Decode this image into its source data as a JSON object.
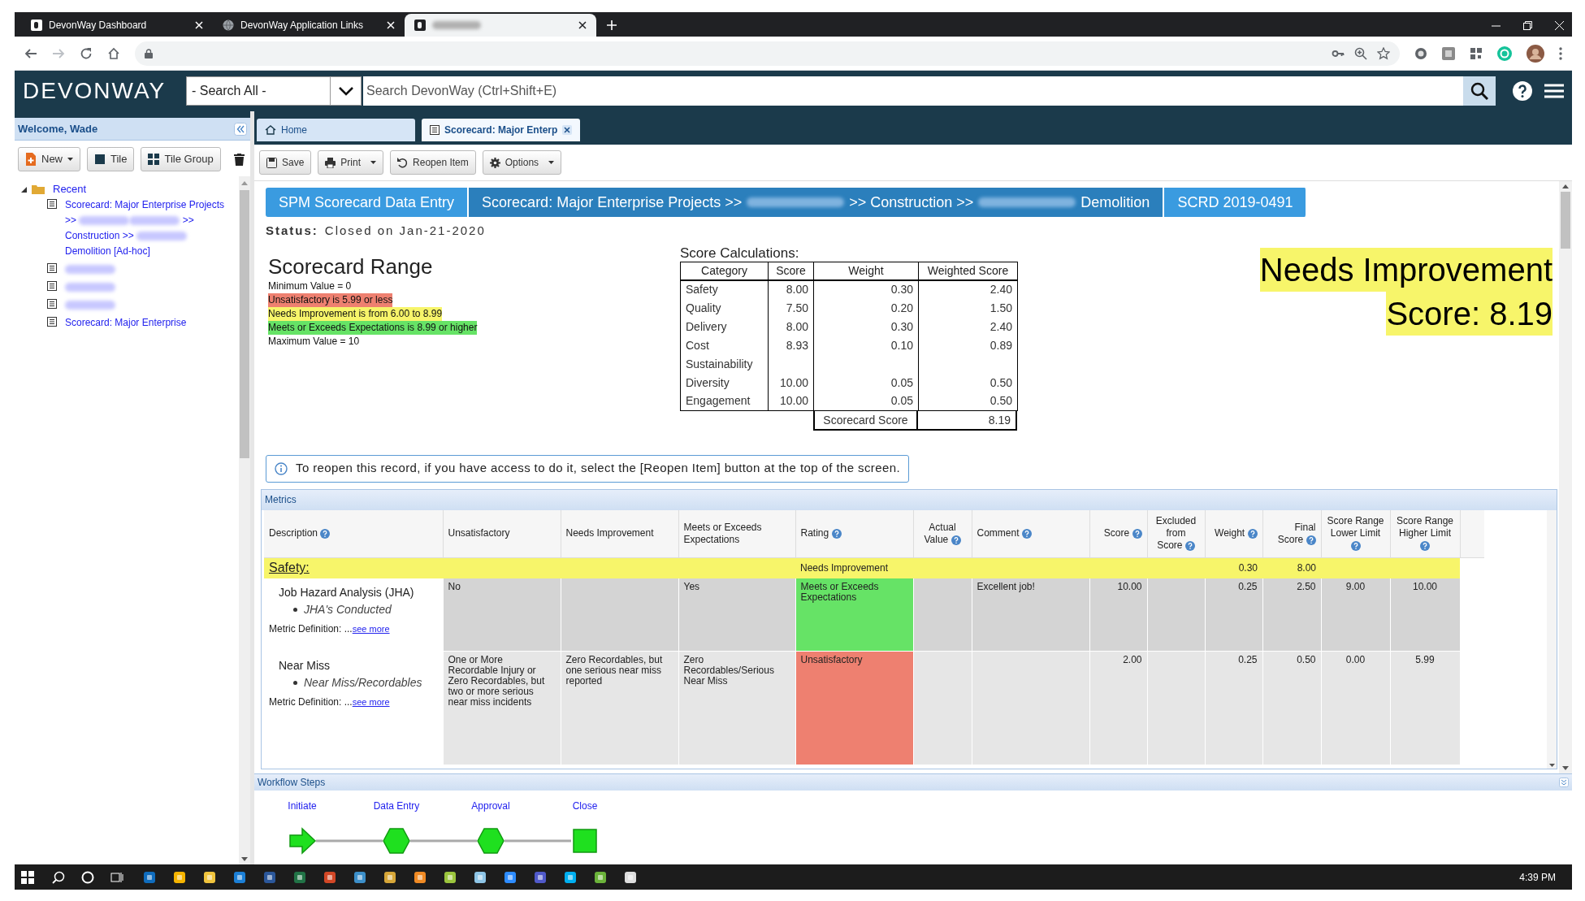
{
  "browser": {
    "tabs": [
      {
        "title": "DevonWay Dashboard",
        "kind": "logo",
        "selected": false
      },
      {
        "title": "DevonWay Application Links",
        "kind": "globe",
        "selected": false
      },
      {
        "title_blurred": true,
        "kind": "logo",
        "selected": true
      }
    ]
  },
  "app_header": {
    "logo": "DEVONWAY",
    "search_scope": "- Search All -",
    "search_placeholder": "Search DevonWay (Ctrl+Shift+E)"
  },
  "sidebar": {
    "title": "Welcome, Wade",
    "buttons": [
      {
        "label": "New",
        "kind": "new",
        "dropdown": true
      },
      {
        "label": "Tile",
        "kind": "tile",
        "dropdown": false
      },
      {
        "label": "Tile Group",
        "kind": "tile_group",
        "dropdown": false
      }
    ],
    "tree": [
      {
        "label": "Recent",
        "expanded": true,
        "children": [
          {
            "parts": [
              {
                "text": "Scorecard: Major Enterprise Projects >> "
              },
              {
                "kind": "blurred"
              },
              {
                "kind": "blurred"
              },
              {
                "text": " >> Construction >> "
              },
              {
                "kind": "blurred"
              },
              {
                "text": " Demolition [Ad-hoc]"
              }
            ]
          },
          {
            "parts": [
              {
                "kind": "blurred"
              }
            ]
          },
          {
            "parts": [
              {
                "kind": "blurred"
              }
            ]
          },
          {
            "parts": [
              {
                "kind": "blurred"
              }
            ]
          },
          {
            "parts": [
              {
                "text": "Scorecard: Major Enterprise"
              }
            ]
          }
        ]
      }
    ]
  },
  "main_tabs": [
    {
      "label": "Home",
      "kind": "home",
      "selected": false,
      "closable": false
    },
    {
      "label": "Scorecard: Major Enterp",
      "kind": "document",
      "selected": true,
      "closable": true
    }
  ],
  "toolbar": [
    {
      "label": "Save",
      "kind": "save",
      "dropdown": false
    },
    {
      "label": "Print",
      "kind": "print",
      "dropdown": true
    },
    {
      "label": "Reopen Item",
      "kind": "reopen",
      "dropdown": false
    },
    {
      "label": "Options",
      "kind": "options",
      "dropdown": true
    }
  ],
  "breadcrumb": [
    {
      "kind": "light",
      "parts": [
        {
          "text": "SPM Scorecard Data Entry"
        }
      ]
    },
    {
      "kind": "dark",
      "parts": [
        {
          "text": "Scorecard: Major Enterprise Projects >> "
        },
        {
          "kind": "blurred"
        },
        {
          "text": " >> Construction >> "
        },
        {
          "kind": "blurred"
        },
        {
          "text": " Demolition"
        }
      ]
    },
    {
      "kind": "light",
      "parts": [
        {
          "text": "SCRD 2019-0491"
        }
      ]
    }
  ],
  "status": {
    "label": "Status:",
    "value": "Closed on Jan-21-2020"
  },
  "scorecard_range": {
    "title": "Scorecard Range",
    "lines": [
      {
        "text": "Minimum Value = 0"
      },
      {
        "text": "Unsatisfactory is 5.99 or less",
        "color": "#ee8070"
      },
      {
        "text": "Needs Improvement is from 6.00 to 8.99",
        "color": "#f7f56a"
      },
      {
        "text": "Meets or Exceeds Expectations is 8.99 or higher",
        "color": "#66e366"
      },
      {
        "text": "Maximum Value = 10"
      }
    ]
  },
  "score_calculations": {
    "title": "Score Calculations:",
    "columns": [
      "Category",
      "Score",
      "Weight",
      "Weighted Score"
    ],
    "rows": [
      [
        "Safety",
        "8.00",
        "0.30",
        "2.40"
      ],
      [
        "Quality",
        "7.50",
        "0.20",
        "1.50"
      ],
      [
        "Delivery",
        "8.00",
        "0.30",
        "2.40"
      ],
      [
        "Cost",
        "8.93",
        "0.10",
        "0.89"
      ],
      [
        "Sustainability"
      ],
      [
        "Diversity",
        "10.00",
        "0.05",
        "0.50"
      ],
      [
        "Engagement",
        "10.00",
        "0.05",
        "0.50"
      ]
    ],
    "total_label": "Scorecard Score",
    "total": "8.19"
  },
  "result": {
    "rating": "Needs Improvement",
    "score": "Score: 8.19"
  },
  "notice": "To reopen this record, if you have access to do it, select the [Reopen Item] button at the top of the screen.",
  "metrics": {
    "title": "Metrics",
    "columns": [
      {
        "label": "Description",
        "kind": "description",
        "help": true
      },
      {
        "label": "Unsatisfactory",
        "kind": "text",
        "help": false
      },
      {
        "label": "Needs Improvement",
        "kind": "text",
        "help": false
      },
      {
        "label": "Meets or Exceeds Expectations",
        "kind": "text",
        "help": false
      },
      {
        "label": "Rating",
        "kind": "rating",
        "help": true
      },
      {
        "label": "Actual Value",
        "kind": "value",
        "help": true
      },
      {
        "label": "Comment",
        "kind": "text",
        "help": true
      },
      {
        "label": "Score",
        "kind": "number",
        "help": true
      },
      {
        "label": "Excluded from Score",
        "kind": "flag",
        "help": true
      },
      {
        "label": "Weight",
        "kind": "number",
        "help": true
      },
      {
        "label": "Final Score",
        "kind": "number",
        "help": true
      },
      {
        "label": "Score Range Lower Limit",
        "kind": "limit",
        "help": true
      },
      {
        "label": "Score Range Higher Limit",
        "kind": "limit",
        "help": true
      }
    ],
    "rows": [
      {
        "kind": "group",
        "color": "#f7f56a",
        "cells": [
          "Safety:",
          "",
          "",
          "",
          "Needs Improvement",
          "",
          "",
          "",
          "",
          "0.30",
          "8.00",
          "",
          ""
        ]
      },
      {
        "kind": "metric",
        "name": "Job Hazard Analysis (JHA)",
        "measure": "JHA's Conducted",
        "definition_label": "Metric Definition: ...",
        "definition_link": "see more",
        "color": "#66e366",
        "cells": [
          "",
          "No",
          "",
          "Yes",
          "Meets or Exceeds Expectations",
          "",
          "Excellent job!",
          "10.00",
          "",
          "0.25",
          "2.50",
          "9.00",
          "10.00"
        ]
      },
      {
        "kind": "metric",
        "name": "Near Miss",
        "measure": "Near Miss/Recordables",
        "definition_label": "Metric Definition: ...",
        "definition_link": "see more",
        "color": "#ee8070",
        "cells": [
          "",
          "One or More Recordable Injury or Zero Recordables, but two or more serious near miss incidents",
          "Zero Recordables, but one serious near miss reported",
          "Zero Recordables/Serious Near Miss",
          "Unsatisfactory",
          "",
          "",
          "2.00",
          "",
          "0.25",
          "0.50",
          "0.00",
          "5.99"
        ]
      }
    ]
  },
  "workflow": {
    "title": "Workflow Steps",
    "steps": [
      {
        "label": "Initiate",
        "kind": "start"
      },
      {
        "label": "Data Entry",
        "kind": "step"
      },
      {
        "label": "Approval",
        "kind": "step"
      },
      {
        "label": "Close",
        "kind": "end"
      }
    ]
  },
  "taskbar": {
    "time": "4:39 PM"
  }
}
